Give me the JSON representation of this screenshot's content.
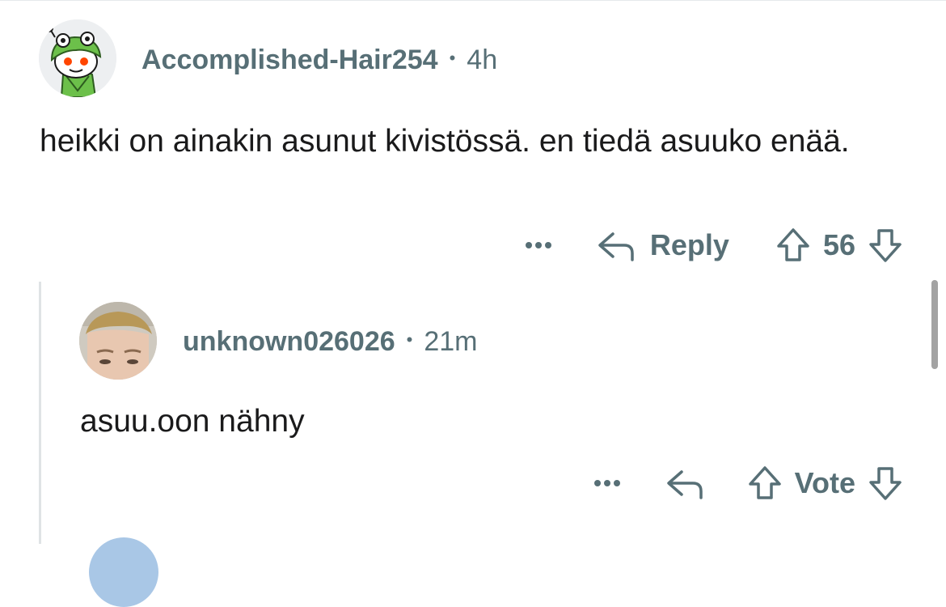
{
  "comments": [
    {
      "username": "Accomplished-Hair254",
      "separator": "•",
      "time": "4h",
      "body": "heikki on ainakin asunut kivistössä. en tiedä asuuko enää.",
      "avatar_icon": "snoo-frog-hood-avatar",
      "actions": {
        "more_icon": "ellipsis-icon",
        "reply_label": "Reply",
        "reply_icon": "reply-arrow-icon",
        "upvote_icon": "upvote-arrow-icon",
        "score": "56",
        "downvote_icon": "downvote-arrow-icon"
      }
    },
    {
      "username": "unknown026026",
      "separator": "•",
      "time": "21m",
      "body": "asuu.oon nähny",
      "avatar_icon": "user-photo-avatar",
      "actions": {
        "more_icon": "ellipsis-icon",
        "reply_icon": "reply-arrow-icon",
        "upvote_icon": "upvote-arrow-icon",
        "vote_label": "Vote",
        "downvote_icon": "downvote-arrow-icon"
      }
    }
  ],
  "colors": {
    "meta_text": "#576f76",
    "body_text": "#1a1a1b",
    "thread_line": "#dfe3e5",
    "avatar_green": "#6cc04a",
    "avatar_orange": "#ff4500"
  }
}
